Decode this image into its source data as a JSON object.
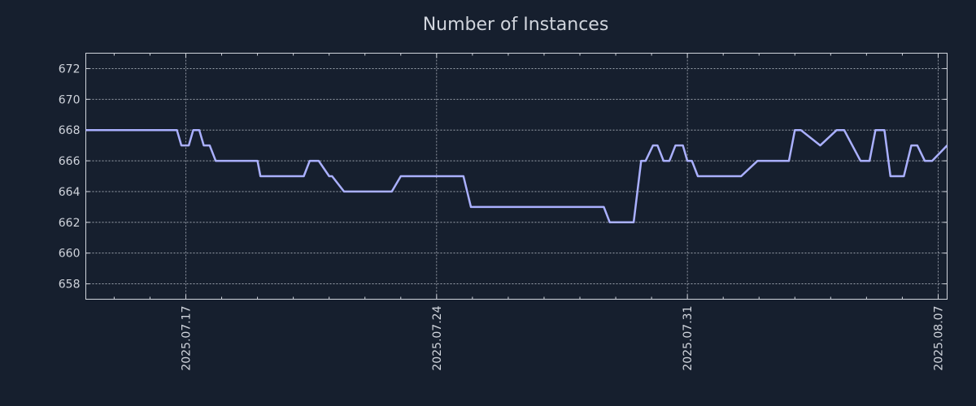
{
  "chart_data": {
    "type": "line",
    "title": "Number of Instances",
    "xlabel": "",
    "ylabel": "",
    "grid": true,
    "legend": "none",
    "xlim": [
      "2025-07-14 05:00",
      "2025-08-07 06:00"
    ],
    "ylim": [
      657,
      673
    ],
    "yticks": [
      658,
      660,
      662,
      664,
      666,
      668,
      670,
      672
    ],
    "xticks": [
      "2025.07.17",
      "2025.07.24",
      "2025.07.31",
      "2025.08.07"
    ],
    "xtick_dates": [
      "2025-07-17 00:00",
      "2025-07-24 00:00",
      "2025-07-31 00:00",
      "2025-08-07 00:00"
    ],
    "minor_xtick_dates": [
      "2025-07-15 00:00",
      "2025-07-16 00:00",
      "2025-07-18 00:00",
      "2025-07-19 00:00",
      "2025-07-20 00:00",
      "2025-07-21 00:00",
      "2025-07-22 00:00",
      "2025-07-23 00:00",
      "2025-07-25 00:00",
      "2025-07-26 00:00",
      "2025-07-27 00:00",
      "2025-07-28 00:00",
      "2025-07-29 00:00",
      "2025-07-30 00:00",
      "2025-08-01 00:00",
      "2025-08-02 00:00",
      "2025-08-03 00:00",
      "2025-08-04 00:00",
      "2025-08-05 00:00",
      "2025-08-06 00:00"
    ],
    "colors": {
      "series": "#aab0ff",
      "background": "#161f2e",
      "text": "#d0d4dc"
    },
    "series": [
      {
        "x": [
          "2025-07-14 05:00",
          "2025-07-16 18:00",
          "2025-07-16 21:00",
          "2025-07-17 02:00",
          "2025-07-17 05:00",
          "2025-07-17 09:00",
          "2025-07-17 12:00",
          "2025-07-17 16:00",
          "2025-07-17 20:00",
          "2025-07-18 05:00",
          "2025-07-19 00:00",
          "2025-07-19 02:00",
          "2025-07-20 07:00",
          "2025-07-20 11:00",
          "2025-07-20 17:00",
          "2025-07-21 00:00",
          "2025-07-21 02:00",
          "2025-07-21 10:00",
          "2025-07-21 13:00",
          "2025-07-22 18:00",
          "2025-07-23 00:00",
          "2025-07-24 18:00",
          "2025-07-24 23:00",
          "2025-07-25 02:00",
          "2025-07-28 16:00",
          "2025-07-28 20:00",
          "2025-07-29 12:00",
          "2025-07-29 17:00",
          "2025-07-29 20:00",
          "2025-07-30 01:00",
          "2025-07-30 04:00",
          "2025-07-30 08:00",
          "2025-07-30 12:00",
          "2025-07-30 16:00",
          "2025-07-30 21:00",
          "2025-07-31 00:00",
          "2025-07-31 03:00",
          "2025-07-31 07:00",
          "2025-08-01 12:00",
          "2025-08-01 23:00",
          "2025-08-02 20:00",
          "2025-08-03 00:00",
          "2025-08-03 04:00",
          "2025-08-03 17:00",
          "2025-08-04 04:00",
          "2025-08-04 09:00",
          "2025-08-04 20:00",
          "2025-08-05 02:00",
          "2025-08-05 06:00",
          "2025-08-05 12:00",
          "2025-08-05 16:00",
          "2025-08-06 01:00",
          "2025-08-06 06:00",
          "2025-08-06 10:00",
          "2025-08-06 15:00",
          "2025-08-06 20:00",
          "2025-08-07 06:00"
        ],
        "values": [
          668,
          668,
          667,
          667,
          668,
          668,
          667,
          667,
          666,
          666,
          666,
          665,
          665,
          666,
          666,
          665,
          665,
          664,
          664,
          664,
          665,
          665,
          663,
          663,
          663,
          662,
          662,
          666,
          666,
          667,
          667,
          666,
          666,
          667,
          667,
          666,
          666,
          665,
          665,
          666,
          666,
          668,
          668,
          667,
          668,
          668,
          666,
          666,
          668,
          668,
          665,
          665,
          667,
          667,
          666,
          666,
          667
        ]
      }
    ]
  }
}
